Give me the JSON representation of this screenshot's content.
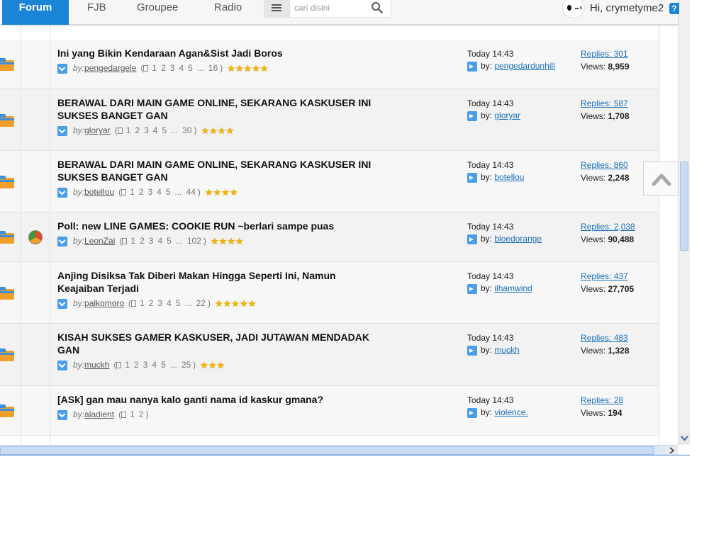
{
  "nav": {
    "tabs": [
      {
        "label": "Forum",
        "active": true
      },
      {
        "label": "FJB",
        "active": false
      },
      {
        "label": "Groupee",
        "active": false
      },
      {
        "label": "Radio",
        "active": false
      }
    ],
    "search_placeholder": "cari disini",
    "greeting": "Hi, crymetyme2",
    "help_label": "?"
  },
  "threads": [
    {
      "title": "Ini yang Bikin Kendaraan Agan&Sist Jadi Boros",
      "by_label": "by:",
      "author": "pengedargele",
      "pages": [
        "1",
        "2",
        "3",
        "4",
        "5",
        "...",
        "16"
      ],
      "stars": 5,
      "last_time": "Today 14:43",
      "last_by_label": "by:",
      "last_user": "pengedardunhill",
      "replies": "Replies: 301",
      "views_label": "Views:",
      "views": "8,959",
      "poll": false
    },
    {
      "title": "BERAWAL DARI MAIN GAME ONLINE, SEKARANG KASKUSER INI SUKSES BANGET GAN",
      "by_label": "by:",
      "author": "gloryar",
      "pages": [
        "1",
        "2",
        "3",
        "4",
        "5",
        "...",
        "30"
      ],
      "stars": 4,
      "last_time": "Today 14:43",
      "last_by_label": "by:",
      "last_user": "gloryar",
      "replies": "Replies: 587",
      "views_label": "Views:",
      "views": "1,708",
      "poll": false
    },
    {
      "title": "BERAWAL DARI MAIN GAME ONLINE, SEKARANG KASKUSER INI SUKSES BANGET GAN",
      "by_label": "by:",
      "author": "botellou",
      "pages": [
        "1",
        "2",
        "3",
        "4",
        "5",
        "...",
        "44"
      ],
      "stars": 4,
      "last_time": "Today 14:43",
      "last_by_label": "by:",
      "last_user": "botellou",
      "replies": "Replies: 860",
      "views_label": "Views:",
      "views": "2,248",
      "poll": false
    },
    {
      "title": "Poll: new LINE GAMES: COOKIE RUN ~berlari sampe puas",
      "by_label": "by:",
      "author": "LeonZai",
      "pages": [
        "1",
        "2",
        "3",
        "4",
        "5",
        "...",
        "102"
      ],
      "stars": 4,
      "last_time": "Today 14:43",
      "last_by_label": "by:",
      "last_user": "bloedorange",
      "replies": "Replies: 2,038",
      "views_label": "Views:",
      "views": "90,488",
      "poll": true
    },
    {
      "title": "Anjing Disiksa Tak Diberi Makan Hingga Seperti Ini, Namun Keajaiban Terjadi",
      "by_label": "by:",
      "author": "palkomoro",
      "pages": [
        "1",
        "2",
        "3",
        "4",
        "5",
        "...",
        "22"
      ],
      "stars": 5,
      "last_time": "Today 14:43",
      "last_by_label": "by:",
      "last_user": "ilhamwind",
      "replies": "Replies: 437",
      "views_label": "Views:",
      "views": "27,705",
      "poll": false
    },
    {
      "title": "KISAH SUKSES GAMER KASKUSER, JADI JUTAWAN MENDADAK GAN",
      "by_label": "by:",
      "author": "muckh",
      "pages": [
        "1",
        "2",
        "3",
        "4",
        "5",
        "...",
        "25"
      ],
      "stars": 3,
      "last_time": "Today 14:43",
      "last_by_label": "by:",
      "last_user": "muckh",
      "replies": "Replies: 483",
      "views_label": "Views:",
      "views": "1,328",
      "poll": false
    },
    {
      "title": "[ASk] gan mau nanya kalo ganti nama id kaskur gmana?",
      "by_label": "by:",
      "author": "aladient",
      "pages": [
        "1",
        "2"
      ],
      "stars": 0,
      "last_time": "Today 14:43",
      "last_by_label": "by:",
      "last_user": "violence.",
      "replies": "Replies: 28",
      "views_label": "Views:",
      "views": "194",
      "poll": false
    }
  ]
}
